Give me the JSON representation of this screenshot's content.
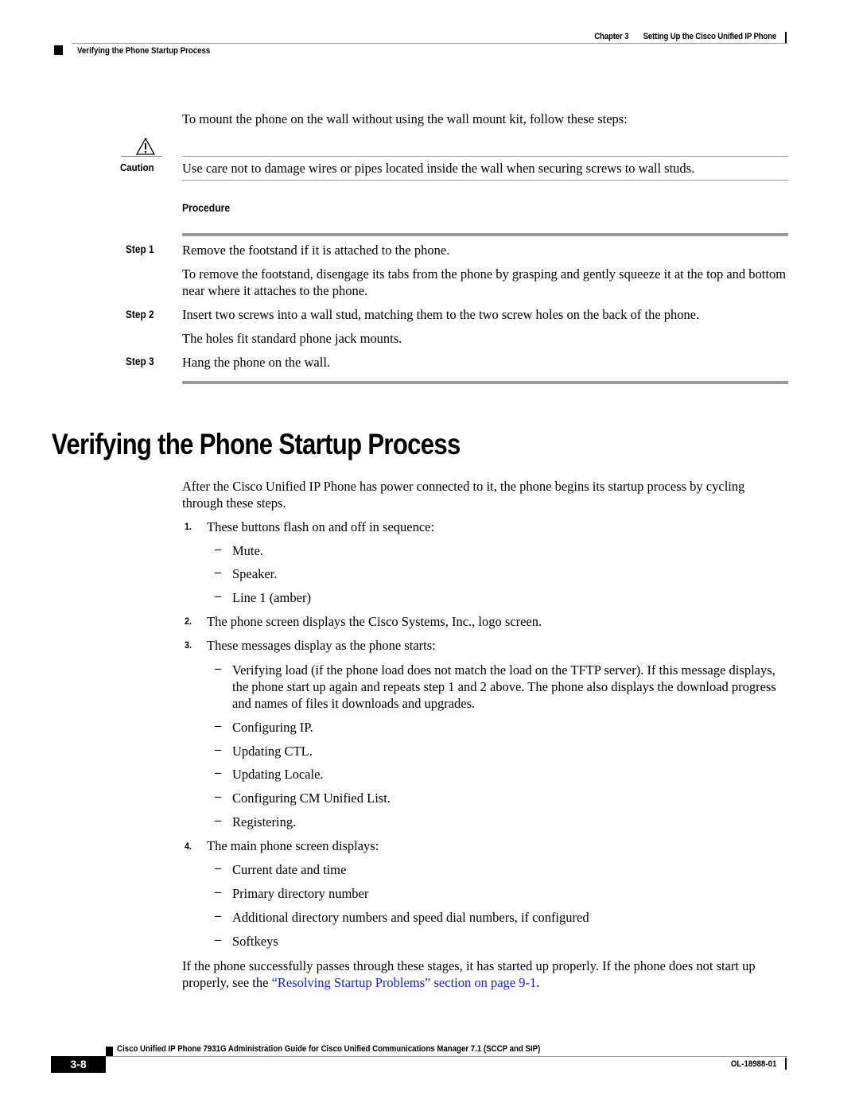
{
  "header": {
    "chapter_number": "Chapter 3",
    "chapter_title": "Setting Up the Cisco Unified IP Phone",
    "section": "Verifying the Phone Startup Process"
  },
  "intro": "To mount the phone on the wall without using the wall mount kit, follow these steps:",
  "caution": {
    "icon": "warning-triangle-icon",
    "label": "Caution",
    "text": "Use care not to damage wires or pipes located inside the wall when securing screws to wall studs."
  },
  "procedure": {
    "heading": "Procedure",
    "steps": [
      {
        "label": "Step 1",
        "text": "Remove the footstand if it is attached to the phone.",
        "detail": "To remove the footstand, disengage its tabs from the phone by grasping and gently squeeze it at the top and bottom near where it attaches to the phone."
      },
      {
        "label": "Step 2",
        "text": "Insert two screws into a wall stud, matching them to the two screw holes on the back of the phone.",
        "detail": "The holes fit standard phone jack mounts."
      },
      {
        "label": "Step 3",
        "text": "Hang the phone on the wall."
      }
    ]
  },
  "section": {
    "title": "Verifying the Phone Startup Process",
    "intro": "After the Cisco Unified IP Phone has power connected to it, the phone begins its startup process by cycling through these steps.",
    "items": [
      {
        "num": "1.",
        "text": "These buttons flash on and off in sequence:",
        "subitems": [
          "Mute.",
          "Speaker.",
          "Line 1 (amber)"
        ]
      },
      {
        "num": "2.",
        "text": "The phone screen displays the Cisco Systems, Inc., logo screen.",
        "subitems": []
      },
      {
        "num": "3.",
        "text": "These messages display as the phone starts:",
        "subitems": [
          "Verifying load (if the phone load does not match the load on the TFTP server). If this message displays, the phone start up again and repeats step 1 and 2 above. The phone also displays the download progress and names of files it downloads and upgrades.",
          "Configuring IP.",
          "Updating CTL.",
          "Updating Locale.",
          "Configuring CM Unified List.",
          "Registering."
        ]
      },
      {
        "num": "4.",
        "text": "The main phone screen displays:",
        "subitems": [
          "Current date and time",
          "Primary directory number",
          "Additional directory numbers and speed dial numbers, if configured",
          "Softkeys"
        ]
      }
    ],
    "dash": "–",
    "closing_before": "If the phone successfully passes through these stages, it has started up properly. If the phone does not start up properly, see the ",
    "closing_link": "“Resolving Startup Problems” section on page 9-1",
    "closing_after": ".",
    "link_color": "#1a1aff"
  },
  "footer": {
    "title": "Cisco Unified IP Phone 7931G Administration Guide for Cisco Unified Communications Manager 7.1 (SCCP and SIP)",
    "page_number": "3-8",
    "doc_number": "OL-18988-01"
  }
}
